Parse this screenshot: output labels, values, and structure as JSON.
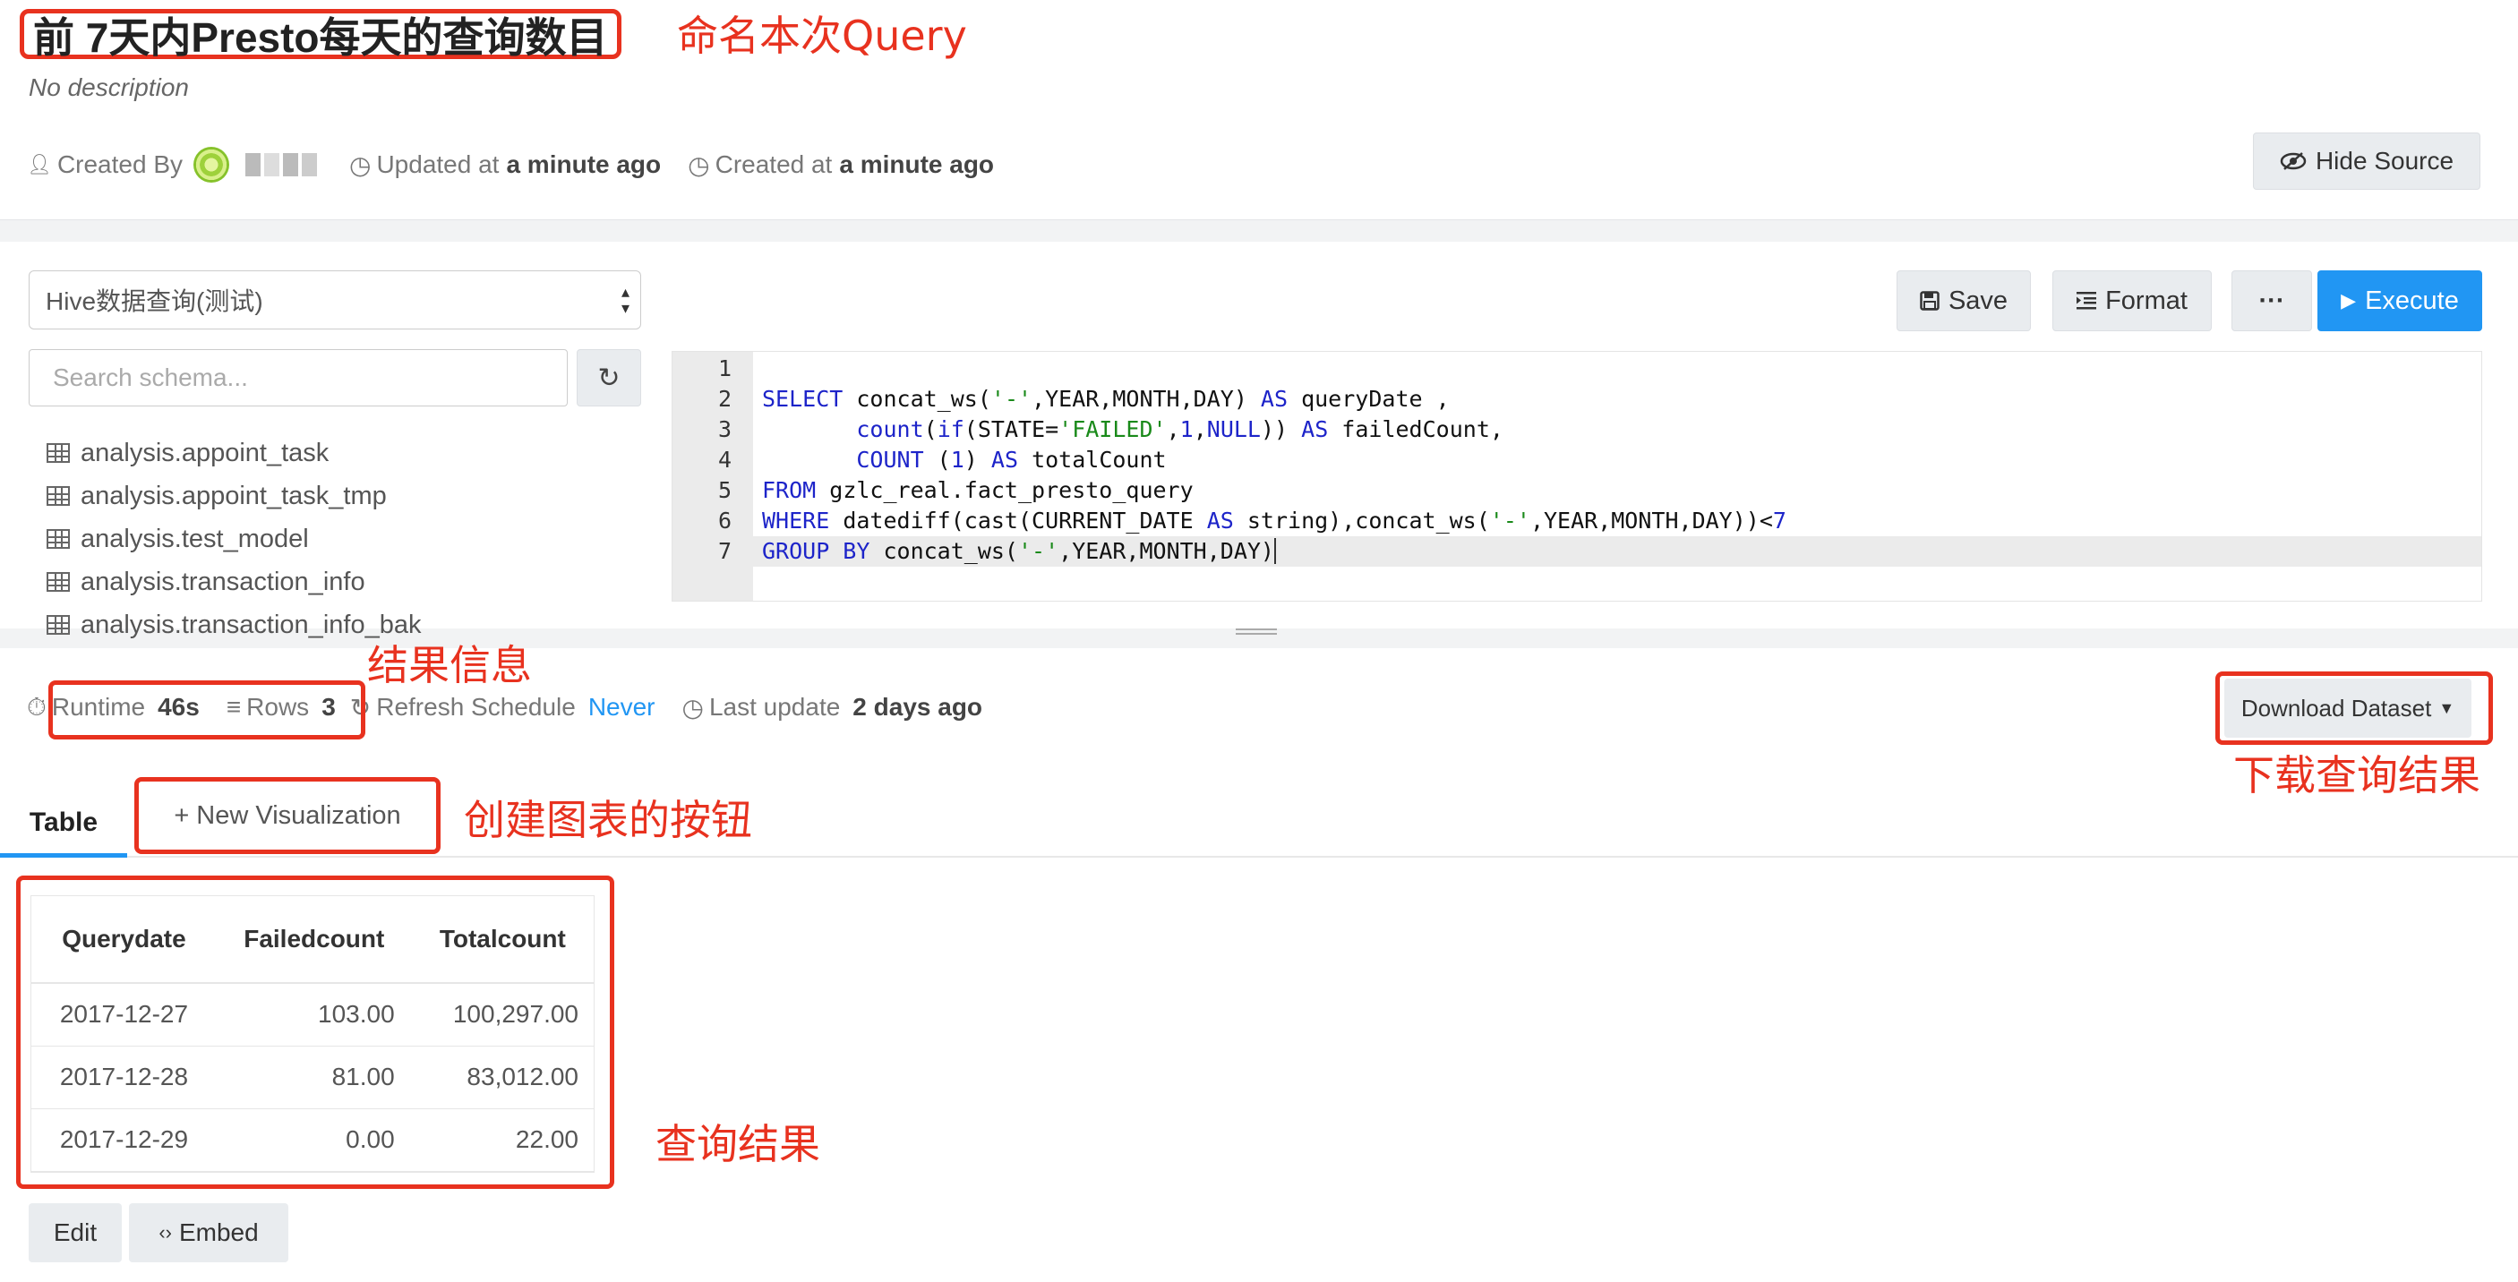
{
  "query": {
    "title": "前 7天内Presto每天的查询数目",
    "description": "No description",
    "created_by_label": "Created By",
    "updated_label": "Updated at",
    "updated_value": "a minute ago",
    "created_label": "Created at",
    "created_value": "a minute ago",
    "hide_source_label": "Hide Source"
  },
  "annotations": {
    "title": "命名本次Query",
    "result_info": "结果信息",
    "download": "下载查询结果",
    "new_viz": "创建图表的按钮",
    "results": "查询结果"
  },
  "editor": {
    "datasource": "Hive数据查询(测试)",
    "search_placeholder": "Search schema...",
    "schema_items": [
      "analysis.appoint_task",
      "analysis.appoint_task_tmp",
      "analysis.test_model",
      "analysis.transaction_info",
      "analysis.transaction_info_bak"
    ],
    "buttons": {
      "save": "Save",
      "format": "Format",
      "more": "···",
      "execute": "Execute"
    },
    "line_numbers": [
      "1",
      "2",
      "3",
      "4",
      "5",
      "6",
      "7"
    ]
  },
  "results": {
    "runtime_label": "Runtime",
    "runtime_value": "46s",
    "rows_label": "Rows",
    "rows_value": "3",
    "refresh_label": "Refresh Schedule",
    "refresh_value": "Never",
    "last_update_label": "Last update",
    "last_update_value": "2 days ago",
    "download_label": "Download Dataset",
    "tab_table": "Table",
    "new_viz_label": "+ New Visualization",
    "columns": [
      "Querydate",
      "Failedcount",
      "Totalcount"
    ],
    "rows": [
      [
        "2017-12-27",
        "103.00",
        "100,297.00"
      ],
      [
        "2017-12-28",
        "81.00",
        "83,012.00"
      ],
      [
        "2017-12-29",
        "0.00",
        "22.00"
      ]
    ],
    "edit_label": "Edit",
    "embed_label": "Embed"
  },
  "colors": {
    "accent": "#2196f3",
    "annotation": "#e8321f"
  }
}
